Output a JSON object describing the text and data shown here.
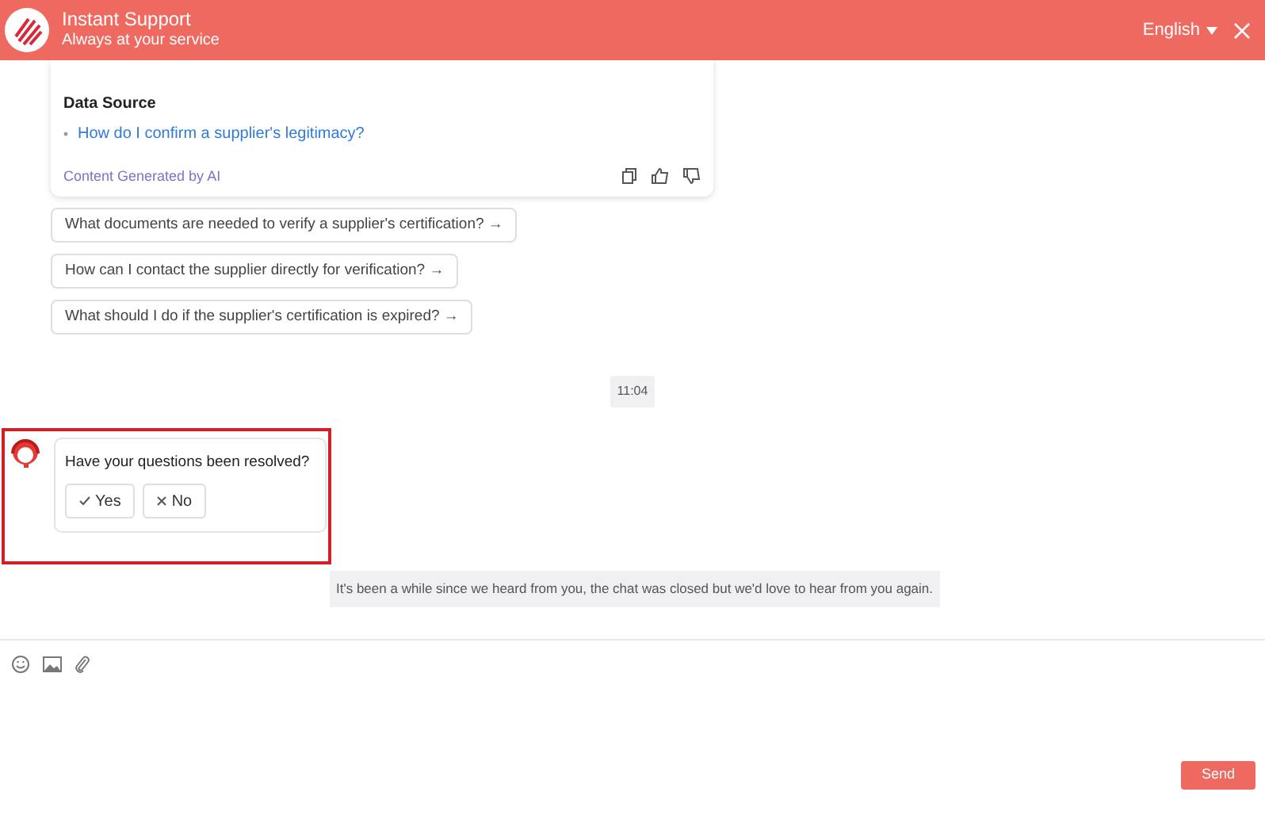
{
  "header": {
    "title": "Instant Support",
    "subtitle": "Always at your service",
    "language": "English"
  },
  "answer_card": {
    "section_title": "Data Source",
    "sources": [
      "How do I confirm a supplier's legitimacy?"
    ],
    "footer": "Content Generated by AI"
  },
  "suggestions": [
    "What documents are needed to verify a supplier's certification? →",
    "How can I contact the supplier directly for verification? →",
    "What should I do if the supplier's certification is expired? →"
  ],
  "timestamp": "11:04",
  "survey": {
    "question": "Have your questions been resolved?",
    "highlighted": true,
    "options": [
      {
        "kind": "yes",
        "label": "Yes"
      },
      {
        "kind": "no",
        "label": "No"
      }
    ]
  },
  "notice": "It's been a while since we heard from you, the chat was closed but we'd love to hear from you again.",
  "composer": {
    "send": "Send"
  }
}
